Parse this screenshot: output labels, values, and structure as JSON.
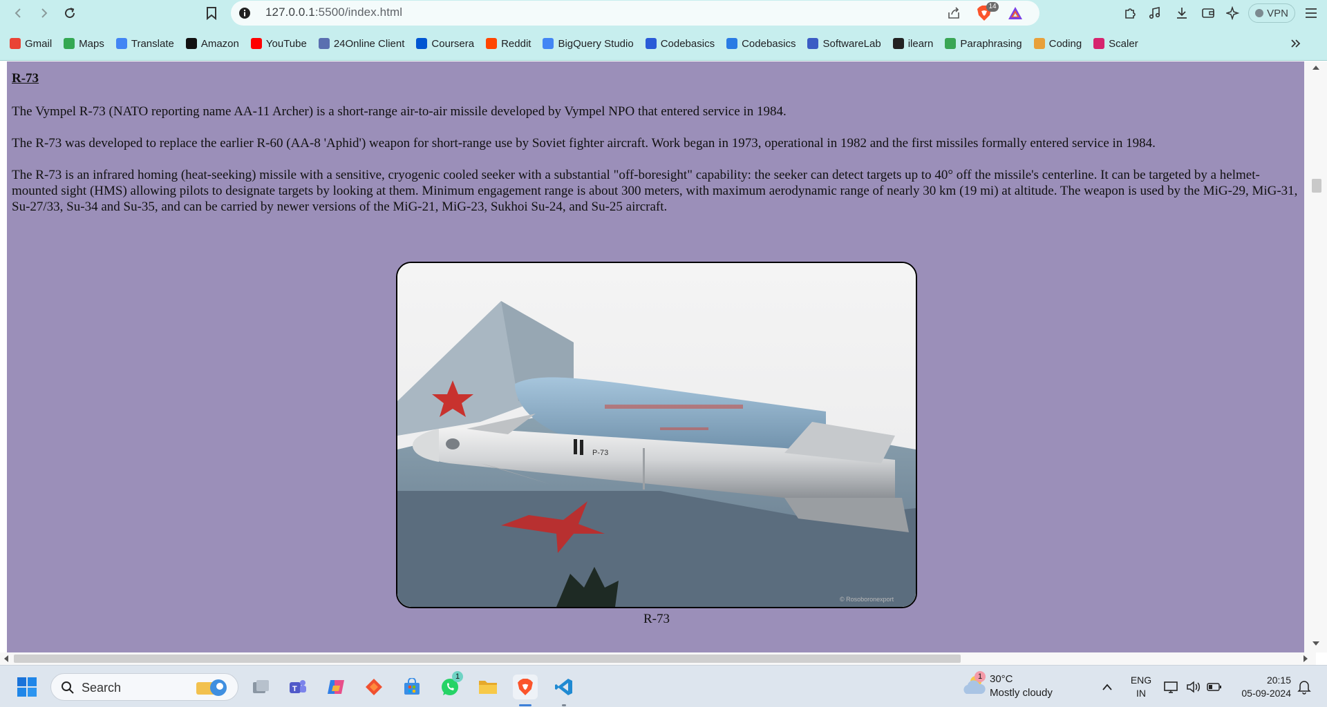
{
  "browser": {
    "url_host": "127.0.0.1",
    "url_rest": ":5500/index.html",
    "brave_shield_count": "14",
    "vpn_label": "VPN"
  },
  "bookmarks": [
    {
      "label": "Gmail",
      "icon": "gmail-icon",
      "color": "#ea4335"
    },
    {
      "label": "Maps",
      "icon": "maps-icon",
      "color": "#34a853"
    },
    {
      "label": "Translate",
      "icon": "translate-icon",
      "color": "#4285f4"
    },
    {
      "label": "Amazon",
      "icon": "amazon-icon",
      "color": "#111111"
    },
    {
      "label": "YouTube",
      "icon": "youtube-icon",
      "color": "#ff0000"
    },
    {
      "label": "24Online Client",
      "icon": "24online-icon",
      "color": "#5a6fb0"
    },
    {
      "label": "Coursera",
      "icon": "coursera-icon",
      "color": "#0056d2"
    },
    {
      "label": "Reddit",
      "icon": "reddit-icon",
      "color": "#ff4500"
    },
    {
      "label": "BigQuery Studio",
      "icon": "bigquery-icon",
      "color": "#4285f4"
    },
    {
      "label": "Codebasics",
      "icon": "codebasics-rocket-icon",
      "color": "#2a5bd7"
    },
    {
      "label": "Codebasics",
      "icon": "codebasics-icon",
      "color": "#2a7be4"
    },
    {
      "label": "SoftwareLab",
      "icon": "softwarelab-icon",
      "color": "#3b5cc4"
    },
    {
      "label": "ilearn",
      "icon": "ilearn-icon",
      "color": "#222222"
    },
    {
      "label": "Paraphrasing",
      "icon": "paraphrasing-icon",
      "color": "#3aa655"
    },
    {
      "label": "Coding",
      "icon": "coding-icon",
      "color": "#e8a03a"
    },
    {
      "label": "Scaler",
      "icon": "scaler-icon",
      "color": "#d6246e"
    }
  ],
  "article": {
    "heading": "R-73",
    "paragraphs": [
      "The Vympel R-73 (NATO reporting name AA-11 Archer) is a short-range air-to-air missile developed by Vympel NPO that entered service in 1984.",
      "The R-73 was developed to replace the earlier R-60 (AA-8 'Aphid') weapon for short-range use by Soviet fighter aircraft. Work began in 1973, operational in 1982 and the first missiles formally entered service in 1984.",
      "The R-73 is an infrared homing (heat-seeking) missile with a sensitive, cryogenic cooled seeker with a substantial \"off-boresight\" capability: the seeker can detect targets up to 40° off the missile's centerline. It can be targeted by a helmet-mounted sight (HMS) allowing pilots to designate targets by looking at them. Minimum engagement range is about 300 meters, with maximum aerodynamic range of nearly 30 km (19 mi) at altitude. The weapon is used by the MiG-29, MiG-31, Su-27/33, Su-34 and Su-35, and can be carried by newer versions of the MiG-21, MiG-23, Sukhoi Su-24, and Su-25 aircraft."
    ],
    "image_caption": "R-73",
    "missile_marking": "Р-73",
    "photo_watermark": "© Rosoboronexport"
  },
  "taskbar": {
    "search_placeholder": "Search",
    "whatsapp_badge": "1",
    "weather_badge": "1",
    "weather_temp": "30°C",
    "weather_desc": "Mostly cloudy",
    "lang_line1": "ENG",
    "lang_line2": "IN",
    "time": "20:15",
    "date": "05-09-2024"
  },
  "colors": {
    "page_background": "#9b8fb9",
    "browser_chrome": "#c7eeee",
    "taskbar": "#dde5ee"
  }
}
